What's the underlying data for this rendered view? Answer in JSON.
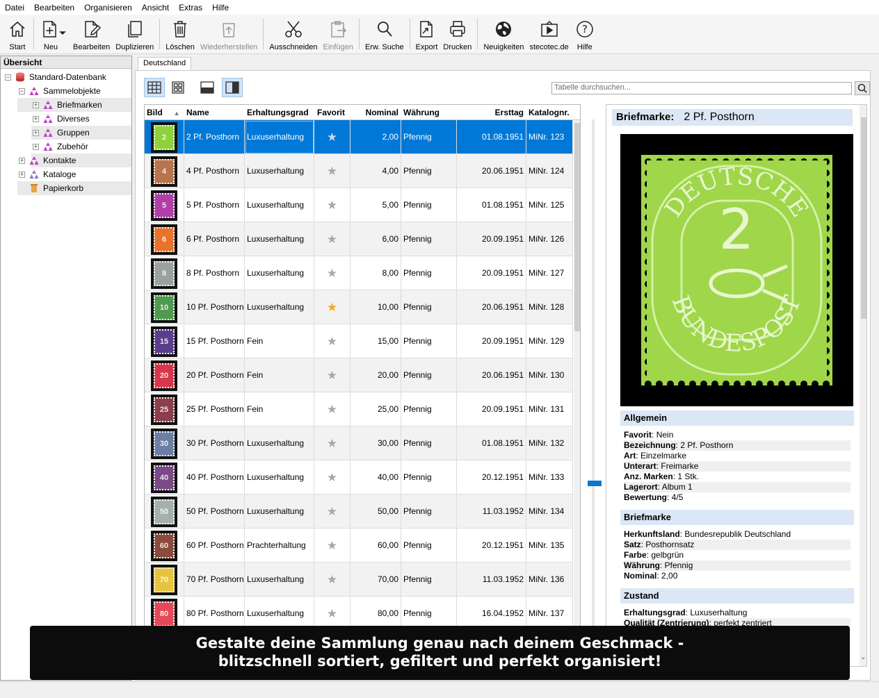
{
  "menu": [
    "Datei",
    "Bearbeiten",
    "Organisieren",
    "Ansicht",
    "Extras",
    "Hilfe"
  ],
  "toolbar": {
    "start": "Start",
    "neu": "Neu",
    "bearbeiten": "Bearbeiten",
    "duplizieren": "Duplizieren",
    "loeschen": "Löschen",
    "wiederherstellen": "Wiederherstellen",
    "ausschneiden": "Ausschneiden",
    "einfuegen": "Einfügen",
    "erw_suche": "Erw. Suche",
    "export": "Export",
    "drucken": "Drucken",
    "neuigkeiten": "Neuigkeiten",
    "stecotec": "stecotec.de",
    "hilfe": "Hilfe"
  },
  "sidebar": {
    "title": "Übersicht",
    "items": [
      "Standard-Datenbank",
      "Sammelobjekte",
      "Briefmarken",
      "Diverses",
      "Gruppen",
      "Zubehör",
      "Kontakte",
      "Kataloge",
      "Papierkorb"
    ]
  },
  "tab": "Deutschland",
  "search": {
    "placeholder": "Tabelle durchsuchen..."
  },
  "table": {
    "headers": [
      "Bild",
      "Name",
      "Erhaltungsgrad",
      "Favorit",
      "Nominal",
      "Währung",
      "Ersttag",
      "Katalognr."
    ],
    "rows": [
      {
        "thumb": "2",
        "name": "2 Pf. Posthorn",
        "grade": "Luxuserhaltung",
        "nominal": "2,00",
        "currency": "Pfennig",
        "date": "01.08.1951",
        "cat": "MiNr. 123",
        "fav": false,
        "color": "#8fd13b"
      },
      {
        "thumb": "4",
        "name": "4 Pf. Posthorn",
        "grade": "Luxuserhaltung",
        "nominal": "4,00",
        "currency": "Pfennig",
        "date": "20.06.1951",
        "cat": "MiNr. 124",
        "fav": false,
        "color": "#b8744d"
      },
      {
        "thumb": "5",
        "name": "5 Pf. Posthorn",
        "grade": "Luxuserhaltung",
        "nominal": "5,00",
        "currency": "Pfennig",
        "date": "01.08.1951",
        "cat": "MiNr. 125",
        "fav": false,
        "color": "#b23fa8"
      },
      {
        "thumb": "6",
        "name": "6 Pf. Posthorn",
        "grade": "Luxuserhaltung",
        "nominal": "6,00",
        "currency": "Pfennig",
        "date": "20.09.1951",
        "cat": "MiNr. 126",
        "fav": false,
        "color": "#e8732b"
      },
      {
        "thumb": "8",
        "name": "8 Pf. Posthorn",
        "grade": "Luxuserhaltung",
        "nominal": "8,00",
        "currency": "Pfennig",
        "date": "20.09.1951",
        "cat": "MiNr. 127",
        "fav": false,
        "color": "#9aa1a1"
      },
      {
        "thumb": "10",
        "name": "10 Pf. Posthorn",
        "grade": "Luxuserhaltung",
        "nominal": "10,00",
        "currency": "Pfennig",
        "date": "20.06.1951",
        "cat": "MiNr. 128",
        "fav": true,
        "color": "#4f9a4f"
      },
      {
        "thumb": "15",
        "name": "15 Pf. Posthorn",
        "grade": "Fein",
        "nominal": "15,00",
        "currency": "Pfennig",
        "date": "20.09.1951",
        "cat": "MiNr. 129",
        "fav": false,
        "color": "#5a3e8c"
      },
      {
        "thumb": "20",
        "name": "20 Pf. Posthorn",
        "grade": "Fein",
        "nominal": "20,00",
        "currency": "Pfennig",
        "date": "20.06.1951",
        "cat": "MiNr. 130",
        "fav": false,
        "color": "#d6374a"
      },
      {
        "thumb": "25",
        "name": "25 Pf. Posthorn",
        "grade": "Fein",
        "nominal": "25,00",
        "currency": "Pfennig",
        "date": "20.09.1951",
        "cat": "MiNr. 131",
        "fav": false,
        "color": "#8a3f4a"
      },
      {
        "thumb": "30",
        "name": "30 Pf. Posthorn",
        "grade": "Luxuserhaltung",
        "nominal": "30,00",
        "currency": "Pfennig",
        "date": "01.08.1951",
        "cat": "MiNr. 132",
        "fav": false,
        "color": "#6c7ea3"
      },
      {
        "thumb": "40",
        "name": "40 Pf. Posthorn",
        "grade": "Luxuserhaltung",
        "nominal": "40,00",
        "currency": "Pfennig",
        "date": "20.12.1951",
        "cat": "MiNr. 133",
        "fav": false,
        "color": "#7a4a86"
      },
      {
        "thumb": "50",
        "name": "50 Pf. Posthorn",
        "grade": "Luxuserhaltung",
        "nominal": "50,00",
        "currency": "Pfennig",
        "date": "11.03.1952",
        "cat": "MiNr. 134",
        "fav": false,
        "color": "#a5b0aa"
      },
      {
        "thumb": "60",
        "name": "60 Pf. Posthorn",
        "grade": "Prachterhaltung",
        "nominal": "60,00",
        "currency": "Pfennig",
        "date": "20.12.1951",
        "cat": "MiNr. 135",
        "fav": false,
        "color": "#8a4a3c"
      },
      {
        "thumb": "70",
        "name": "70 Pf. Posthorn",
        "grade": "Luxuserhaltung",
        "nominal": "70,00",
        "currency": "Pfennig",
        "date": "11.03.1952",
        "cat": "MiNr. 136",
        "fav": false,
        "color": "#e7c43f"
      },
      {
        "thumb": "80",
        "name": "80 Pf. Posthorn",
        "grade": "Luxuserhaltung",
        "nominal": "80,00",
        "currency": "Pfennig",
        "date": "16.04.1952",
        "cat": "MiNr. 137",
        "fav": false,
        "color": "#e24a5a"
      }
    ]
  },
  "detail": {
    "title_key": "Briefmarke:",
    "title_val": "2 Pf. Posthorn",
    "stamp": {
      "top": "DEUTSCHE",
      "bottom": "BUNDESPOST",
      "value": "2",
      "color": "#9fd64a"
    },
    "sections": [
      {
        "title": "Allgemein",
        "items": [
          {
            "k": "Favorit",
            "v": "Nein"
          },
          {
            "k": "Bezeichnung",
            "v": "2 Pf. Posthorn"
          },
          {
            "k": "Art",
            "v": "Einzelmarke"
          },
          {
            "k": "Unterart",
            "v": "Freimarke"
          },
          {
            "k": "Anz. Marken",
            "v": "1 Stk."
          },
          {
            "k": "Lagerort",
            "v": "Album 1"
          },
          {
            "k": "Bewertung",
            "v": "4/5"
          }
        ]
      },
      {
        "title": "Briefmarke",
        "items": [
          {
            "k": "Herkunftsland",
            "v": "Bundesrepublik Deutschland"
          },
          {
            "k": "Satz",
            "v": "Posthornsatz"
          },
          {
            "k": "Farbe",
            "v": "gelbgrün"
          },
          {
            "k": "Währung",
            "v": "Pfennig"
          },
          {
            "k": "Nominal",
            "v": "2,00"
          }
        ]
      },
      {
        "title": "Zustand",
        "items": [
          {
            "k": "Erhaltungsgrad",
            "v": "Luxuserhaltung"
          },
          {
            "k": "Qualität (Zentrierung)",
            "v": "perfekt zentriert"
          }
        ]
      }
    ]
  },
  "banner": {
    "line1": "Gestalte deine Sammlung genau nach deinem Geschmack -",
    "line2": "blitzschnell sortiert, gefiltert und perfekt organisiert!"
  },
  "colors": {
    "accent": "#0078d7",
    "section": "#dbe7f4",
    "star_active": "#f5a623"
  }
}
